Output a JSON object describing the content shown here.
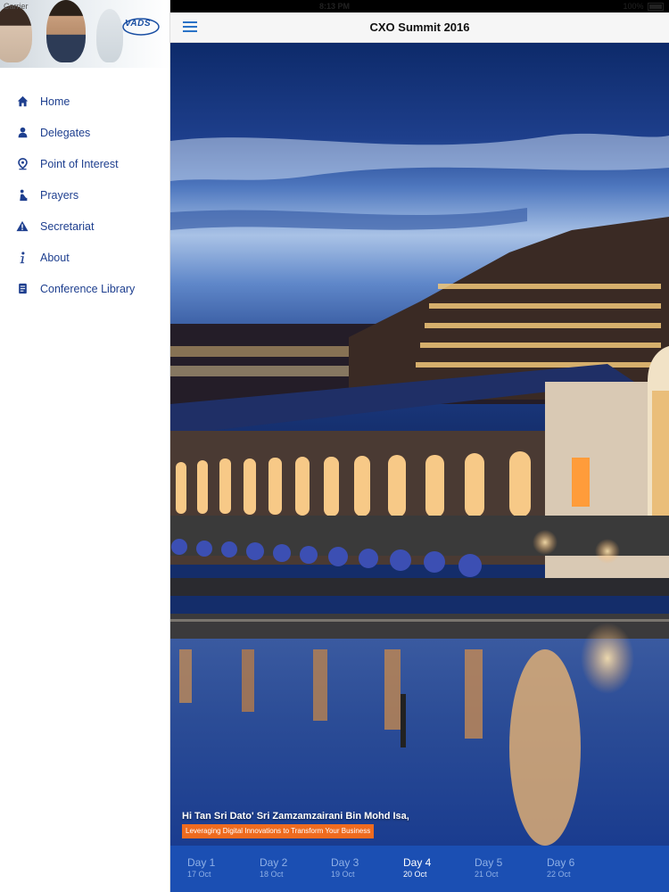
{
  "status_bar": {
    "carrier": "Carrier",
    "time": "8:13 PM",
    "battery": "100%"
  },
  "sidebar": {
    "logo_text": "VADS",
    "items": [
      {
        "label": "Home",
        "icon": "home-icon"
      },
      {
        "label": "Delegates",
        "icon": "person-icon"
      },
      {
        "label": "Point of Interest",
        "icon": "map-pin-icon"
      },
      {
        "label": "Prayers",
        "icon": "prayer-icon"
      },
      {
        "label": "Secretariat",
        "icon": "warning-icon"
      },
      {
        "label": "About",
        "icon": "info-icon"
      },
      {
        "label": "Conference Library",
        "icon": "document-icon"
      }
    ]
  },
  "header": {
    "title": "CXO Summit 2016",
    "menu_icon": "hamburger-icon"
  },
  "hero": {
    "greeting": "Hi Tan Sri Dato' Sri Zamzamzairani Bin Mohd Isa,",
    "tagline": "Leveraging Digital Innovations to Transform Your Business"
  },
  "days": {
    "active_index": 3,
    "tabs": [
      {
        "label": "Day 1",
        "date": "17 Oct"
      },
      {
        "label": "Day 2",
        "date": "18 Oct"
      },
      {
        "label": "Day 3",
        "date": "19 Oct"
      },
      {
        "label": "Day 4",
        "date": "20 Oct"
      },
      {
        "label": "Day 5",
        "date": "21 Oct"
      },
      {
        "label": "Day 6",
        "date": "22 Oct"
      }
    ]
  },
  "colors": {
    "accent": "#1b4fb3",
    "nav_text": "#1e3f8f",
    "tagline_bg": "#ef6b1f",
    "menu_icon": "#2a73c7"
  }
}
